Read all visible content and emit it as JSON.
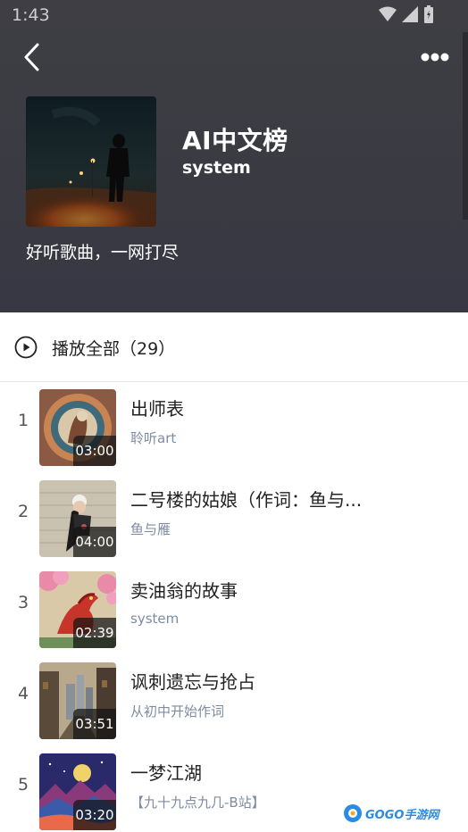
{
  "status_bar": {
    "time": "1:43"
  },
  "header": {
    "title": "AI中文榜",
    "author": "system",
    "description": "好听歌曲，一网打尽"
  },
  "play_all": {
    "label": "播放全部（29）"
  },
  "songs": [
    {
      "index": "1",
      "title": "出师表",
      "artist": "聆听art",
      "duration": "03:00"
    },
    {
      "index": "2",
      "title": "二号楼的姑娘（作词：鱼与...",
      "artist": "鱼与雁",
      "duration": "04:00"
    },
    {
      "index": "3",
      "title": "卖油翁的故事",
      "artist": "system",
      "duration": "02:39"
    },
    {
      "index": "4",
      "title": "讽刺遗忘与抢占",
      "artist": "从初中开始作词",
      "duration": "03:51"
    },
    {
      "index": "5",
      "title": "一梦江湖",
      "artist": "【九十九点九几-B站】",
      "duration": "03:20"
    }
  ],
  "watermark": {
    "text": "GOGO手游网"
  },
  "colors": {
    "header_bg": "#3c3c42",
    "artist_text": "#7d8ba0",
    "watermark": "#2a8be6"
  }
}
